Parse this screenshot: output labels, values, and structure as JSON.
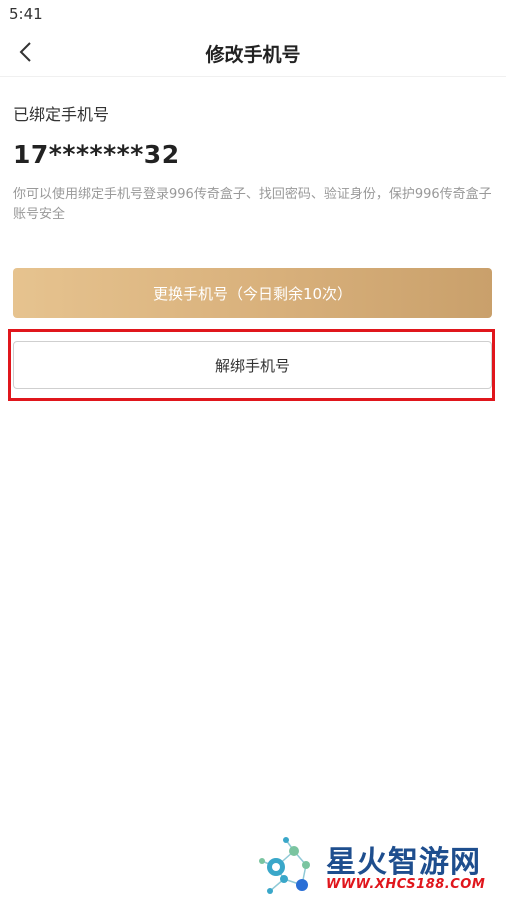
{
  "status_bar": {
    "time": "5:41"
  },
  "nav": {
    "title": "修改手机号",
    "back_icon": "chevron-left-icon"
  },
  "bound_phone": {
    "label": "已绑定手机号",
    "number": "17*******32",
    "description": "你可以使用绑定手机号登录996传奇盒子、找回密码、验证身份，保护996传奇盒子账号安全"
  },
  "actions": {
    "change_label": "更换手机号（今日剩余10次）",
    "unbind_label": "解绑手机号"
  },
  "watermark": {
    "title": "星火智游网",
    "url": "WWW.XHCS188.COM"
  },
  "colors": {
    "accent_gold": "#d8b07b",
    "highlight_red": "#e0161c",
    "watermark_blue": "#1e4e8e"
  }
}
